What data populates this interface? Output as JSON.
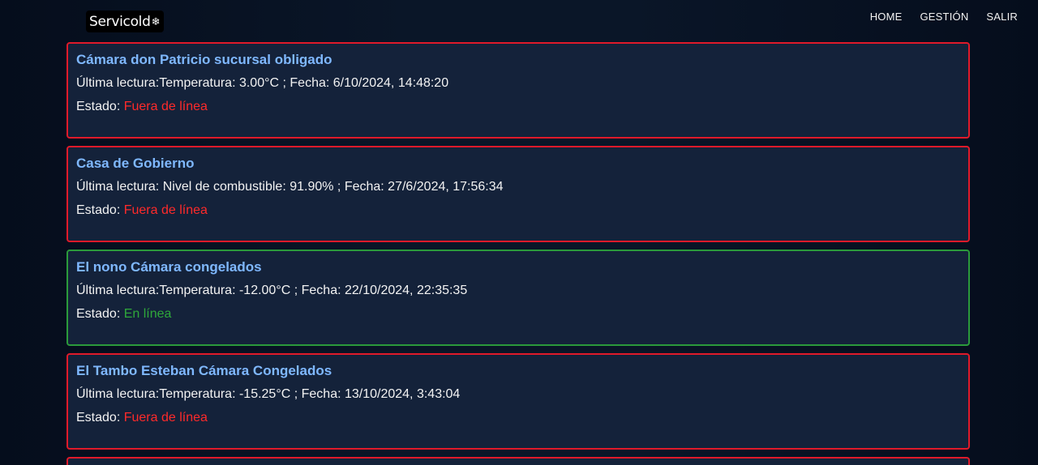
{
  "brand": {
    "name": "Servicold",
    "icon": "snowflake-icon"
  },
  "nav": {
    "home": "HOME",
    "gestion": "GESTIÓN",
    "salir": "SALIR"
  },
  "labels": {
    "reading_prefix": "Última lectura:",
    "status_prefix": "Estado:"
  },
  "colors": {
    "title": "#7fb8ff",
    "offline": "#ff2a2a",
    "online": "#2fa83a",
    "card_bg": "#14223a"
  },
  "devices": [
    {
      "name": "Cámara don Patricio sucursal obligado",
      "reading": "Temperatura: 3.00°C ; Fecha: 6/10/2024, 14:48:20",
      "status": "Fuera de línea",
      "online": false
    },
    {
      "name": "Casa de Gobierno",
      "reading": "Nivel de combustible: 91.90% ; Fecha: 27/6/2024, 17:56:34",
      "status": "Fuera de línea",
      "online": false
    },
    {
      "name": "El nono Cámara congelados",
      "reading": "Temperatura: -12.00°C ; Fecha: 22/10/2024, 22:35:35",
      "status": "En línea",
      "online": true
    },
    {
      "name": "El Tambo Esteban Cámara Congelados",
      "reading": "Temperatura: -15.25°C ; Fecha: 13/10/2024, 3:43:04",
      "status": "Fuera de línea",
      "online": false
    }
  ]
}
